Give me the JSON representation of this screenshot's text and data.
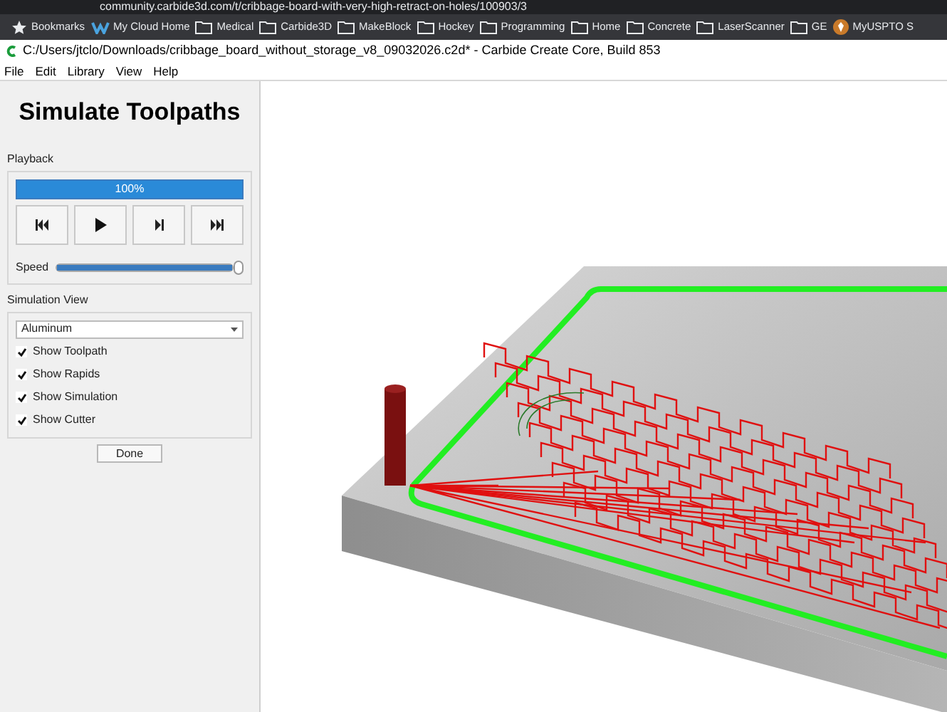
{
  "browser": {
    "url": "community.carbide3d.com/t/cribbage-board-with-very-high-retract-on-holes/100903/3",
    "bookmarks": [
      {
        "label": "Bookmarks",
        "kind": "star"
      },
      {
        "label": "My Cloud Home",
        "kind": "site"
      },
      {
        "label": "Medical",
        "kind": "folder"
      },
      {
        "label": "Carbide3D",
        "kind": "folder"
      },
      {
        "label": "MakeBlock",
        "kind": "folder"
      },
      {
        "label": "Hockey",
        "kind": "folder"
      },
      {
        "label": "Programming",
        "kind": "folder"
      },
      {
        "label": "Home",
        "kind": "folder"
      },
      {
        "label": "Concrete",
        "kind": "folder"
      },
      {
        "label": "LaserScanner",
        "kind": "folder"
      },
      {
        "label": "GE",
        "kind": "folder"
      },
      {
        "label": "MyUSPTO S",
        "kind": "site"
      }
    ]
  },
  "window": {
    "title": "C:/Users/jtclo/Downloads/cribbage_board_without_storage_v8_09032026.c2d* - Carbide Create Core, Build 853"
  },
  "menu": [
    "File",
    "Edit",
    "Library",
    "View",
    "Help"
  ],
  "panel": {
    "title": "Simulate Toolpaths",
    "playback": {
      "label": "Playback",
      "progress": {
        "text": "100%",
        "level": 1
      },
      "buttons": [
        {
          "kind": "first"
        },
        {
          "kind": "play"
        },
        {
          "kind": "step"
        },
        {
          "kind": "last"
        }
      ],
      "speed": {
        "label": "Speed",
        "level": 1
      }
    },
    "simulation_view": {
      "label": "Simulation View",
      "material": "Aluminum",
      "options": [
        {
          "label": "Show Toolpath",
          "checked": true
        },
        {
          "label": "Show Rapids",
          "checked": true
        },
        {
          "label": "Show Simulation",
          "checked": true
        },
        {
          "label": "Show Cutter",
          "checked": true
        }
      ]
    },
    "done": "Done"
  }
}
